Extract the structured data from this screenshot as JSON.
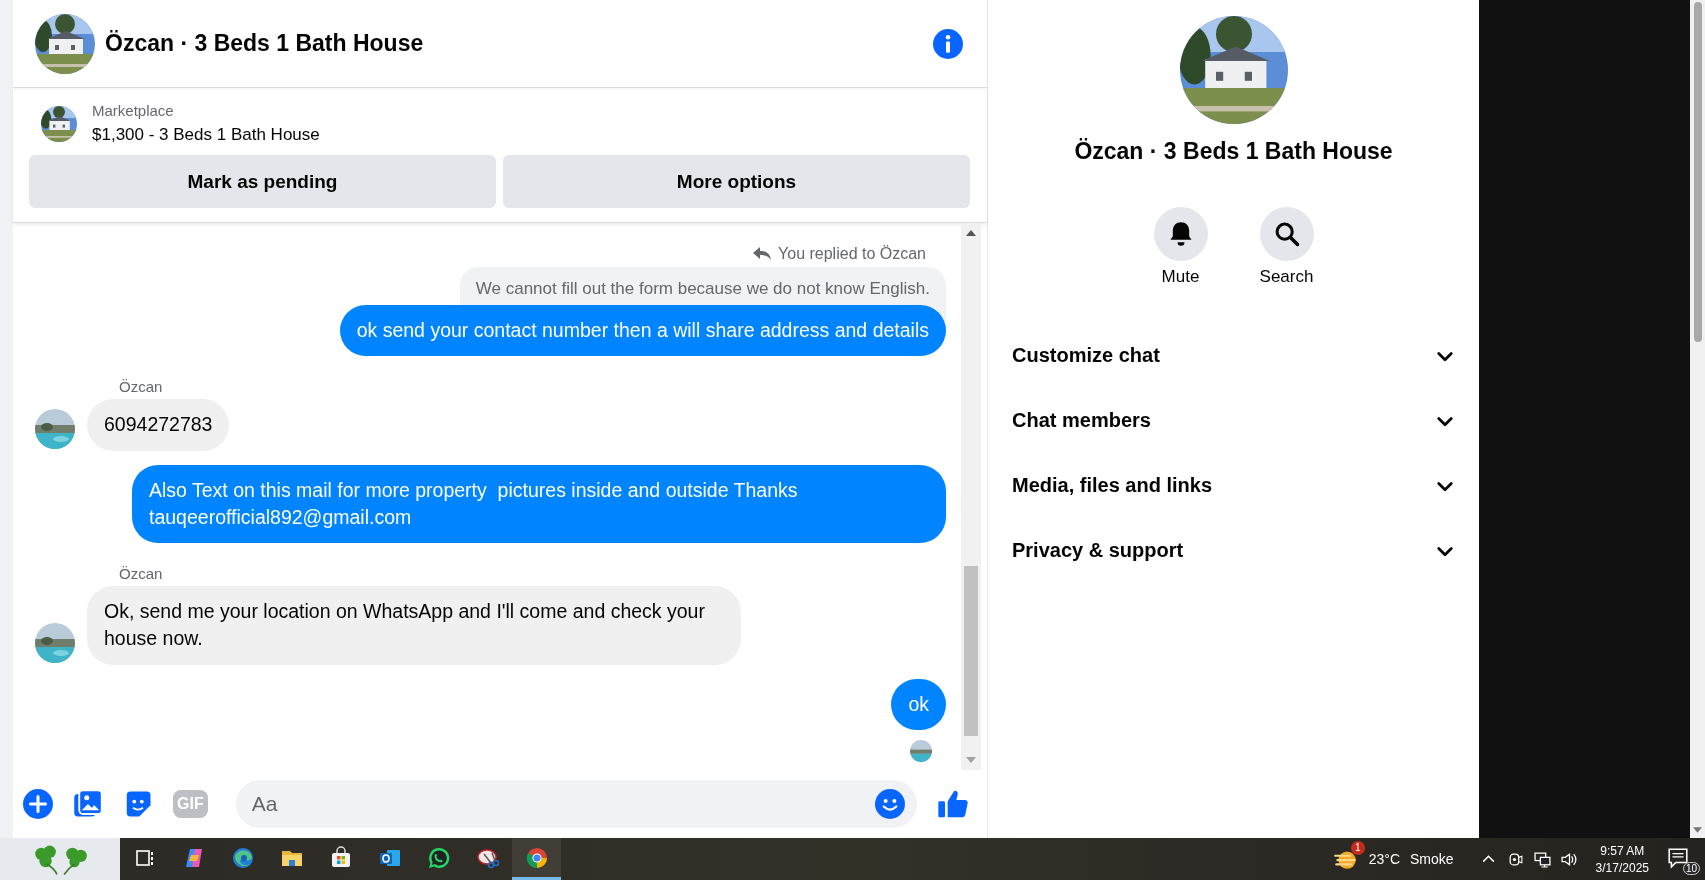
{
  "conversation": {
    "title": "Özcan · 3 Beds 1 Bath House"
  },
  "listing": {
    "source": "Marketplace",
    "title": "$1,300 - 3 Beds 1 Bath House",
    "actions": [
      "Mark as pending",
      "More options"
    ]
  },
  "messages": [
    {
      "kind": "reply_note",
      "text": "You replied to Özcan"
    },
    {
      "kind": "quoted",
      "text": "We cannot fill out the form because we do not know English."
    },
    {
      "kind": "outgoing",
      "text": "ok send your contact number then a will share address and details"
    },
    {
      "kind": "sender",
      "text": "Özcan"
    },
    {
      "kind": "incoming",
      "text": "6094272783"
    },
    {
      "kind": "outgoing",
      "text": "Also Text on this mail for more property  pictures inside and outside Thanks tauqeerofficial892@gmail.com"
    },
    {
      "kind": "sender",
      "text": "Özcan"
    },
    {
      "kind": "incoming",
      "text": "Ok, send me your location on WhatsApp and I'll come and check your house now."
    },
    {
      "kind": "outgoing",
      "text": "ok"
    },
    {
      "kind": "seen"
    }
  ],
  "composer": {
    "placeholder": "Aa",
    "gif_label": "GIF"
  },
  "details": {
    "title": "Özcan · 3 Beds 1 Bath House",
    "actions": [
      {
        "kind": "mute",
        "label": "Mute"
      },
      {
        "kind": "search",
        "label": "Search"
      }
    ],
    "sections": [
      {
        "label": "Customize chat",
        "expanded": false
      },
      {
        "label": "Chat members",
        "expanded": false
      },
      {
        "label": "Media, files and links",
        "expanded": false
      },
      {
        "label": "Privacy & support",
        "expanded": false
      }
    ]
  },
  "taskbar": {
    "apps": [
      {
        "kind": "taskview",
        "selected": false
      },
      {
        "kind": "copilot",
        "selected": false
      },
      {
        "kind": "edge",
        "selected": false
      },
      {
        "kind": "files",
        "selected": false
      },
      {
        "kind": "store",
        "selected": false
      },
      {
        "kind": "outlook",
        "selected": false
      },
      {
        "kind": "whatsapp",
        "selected": false
      },
      {
        "kind": "snip",
        "selected": false
      },
      {
        "kind": "chrome",
        "selected": true
      }
    ],
    "weather": {
      "badge": "1",
      "temperature": "23°C",
      "condition": "Smoke"
    },
    "time": "9:57 AM",
    "date": "3/17/2025",
    "notifications": "10"
  }
}
